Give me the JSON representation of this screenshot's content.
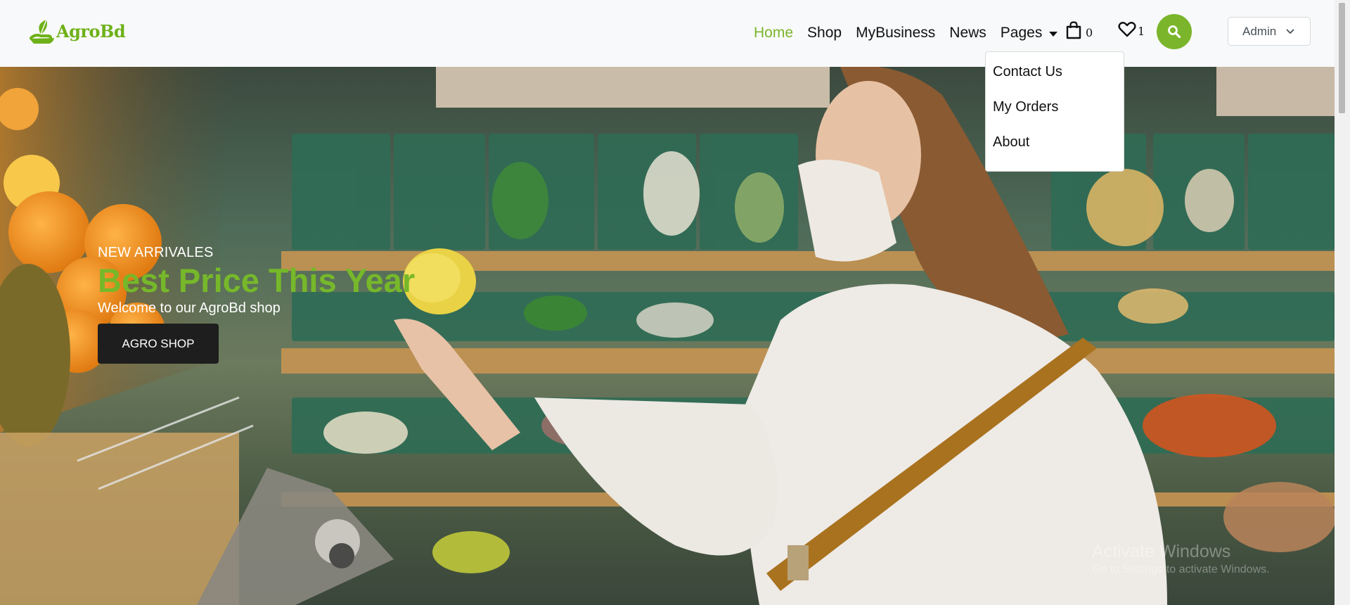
{
  "brand": {
    "name": "AgroBd",
    "color": "#6eb118"
  },
  "nav": {
    "items": [
      "Home",
      "Shop",
      "MyBusiness",
      "News"
    ],
    "pages_label": "Pages",
    "active": "Home",
    "accent": "#7ab52c"
  },
  "cart": {
    "icon": "shopping-bag-icon",
    "count": "0"
  },
  "wishlist": {
    "icon": "heart-icon",
    "count": "1"
  },
  "search": {
    "icon": "search-icon"
  },
  "user_menu": {
    "selected": "Admin"
  },
  "pages_dropdown": {
    "items": [
      "Contact Us",
      "My Orders",
      "About"
    ]
  },
  "hero": {
    "subtitle": "NEW ARRIVALES",
    "title": "Best Price This Year",
    "welcome": "Welcome to our AgroBd shop",
    "button_label": "AGRO SHOP"
  },
  "watermark": {
    "line1": "Activate Windows",
    "line2": "Go to Settings to activate Windows."
  }
}
